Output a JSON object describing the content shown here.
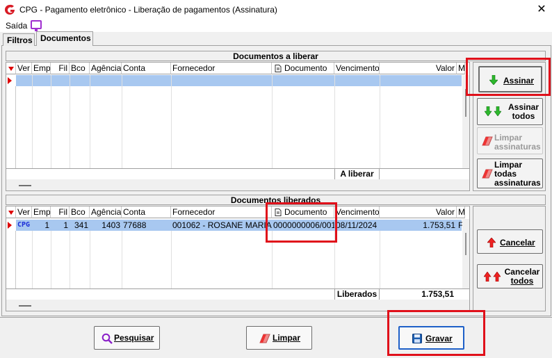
{
  "window": {
    "title": "CPG - Pagamento eletrônico - Liberação de pagamentos (Assinatura)",
    "close_glyph": "✕"
  },
  "menu": {
    "saida": "Saída"
  },
  "tabs": {
    "filtros": "Filtros",
    "documentos": "Documentos"
  },
  "columns": [
    "Ver",
    "Emp",
    "Fil",
    "Bco",
    "Agência",
    "Conta",
    "Fornecedor",
    "Documento",
    "Vencimento",
    "Valor",
    "M"
  ],
  "a_liberar": {
    "title": "Documentos a liberar",
    "footer_label": "A liberar",
    "footer_value": ""
  },
  "liberados": {
    "title": "Documentos liberados",
    "row": {
      "ver": "CPG",
      "emp": "1",
      "fil": "1",
      "bco": "341",
      "agencia": "1403",
      "conta": "77688",
      "fornecedor": "001062 - ROSANE MARIA ...",
      "documento": "0000000006/001",
      "vencimento": "08/11/2024",
      "valor": "1.753,51",
      "m": "F"
    },
    "footer_label": "Liberados",
    "footer_value": "1.753,51"
  },
  "side_buttons": {
    "assinar": "Assinar",
    "assinar_todos_1": "Assinar",
    "assinar_todos_2": "todos",
    "limpar_assin_1": "Limpar",
    "limpar_assin_2": "assinaturas",
    "limpar_todas_1": "Limpar",
    "limpar_todas_2": "todas",
    "limpar_todas_3": "assinaturas",
    "cancelar": "Cancelar",
    "cancelar_todos_1": "Cancelar",
    "cancelar_todos_2": "todos"
  },
  "footer": {
    "pesquisar": "Pesquisar",
    "limpar": "Limpar",
    "gravar": "Gravar"
  },
  "colors": {
    "highlight": "#e0101a",
    "selected_row": "#a8c8f0"
  }
}
